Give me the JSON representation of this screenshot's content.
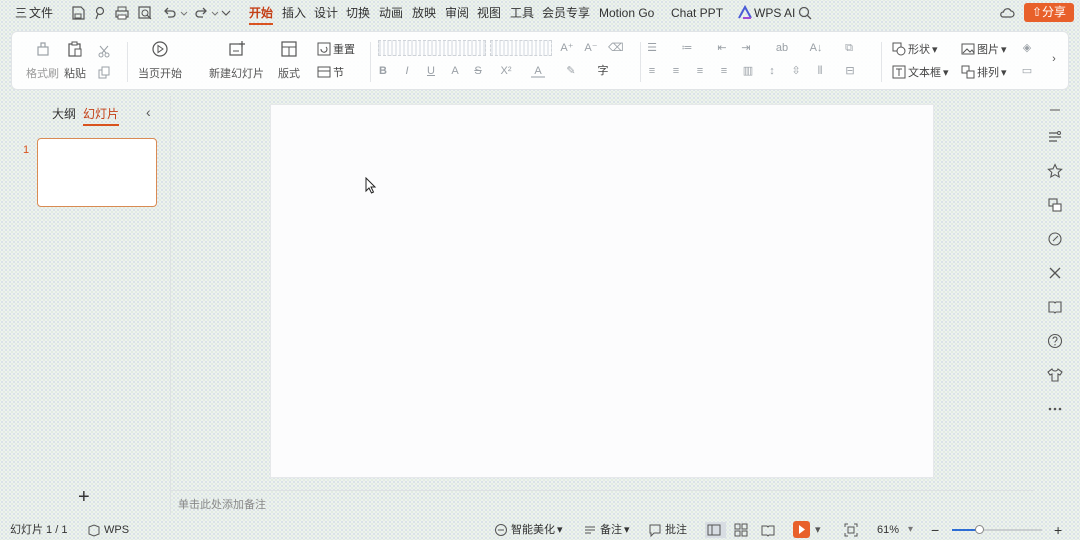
{
  "menubar": {
    "hamburger_label": "三",
    "file": "文件",
    "tabs": [
      "开始",
      "插入",
      "设计",
      "切换",
      "动画",
      "放映",
      "审阅",
      "视图",
      "工具",
      "会员专享",
      "Motion Go",
      "Chat PPT",
      "WPS AI"
    ],
    "active_tab": "开始",
    "share": "分享",
    "accent": "#e8602a"
  },
  "ribbon": {
    "format_painter": "格式刷",
    "paste": "粘贴",
    "play_from_current": "当页开始",
    "new_slide": "新建幻灯片",
    "layout": "版式",
    "reset": "重置",
    "section": "节",
    "shape": "形状",
    "picture": "图片",
    "textbox": "文本框",
    "arrange": "排列",
    "font_buttons": [
      "B",
      "I",
      "U",
      "A",
      "S",
      "X²",
      "A",
      "A"
    ],
    "grow_font": "A⁺",
    "shrink_font": "A⁻"
  },
  "left_panel": {
    "tab_outline": "大纲",
    "tab_slides": "幻灯片",
    "collapse": "‹",
    "slide_number": "1",
    "add_slide": "+"
  },
  "notes": {
    "placeholder": "单击此处添加备注"
  },
  "statusbar": {
    "slide_counter": "幻灯片 1 / 1",
    "theme": "WPS",
    "smart_beautify": "智能美化",
    "notes": "备注",
    "comments": "批注",
    "zoom": "61%",
    "zoom_minus": "−",
    "zoom_plus": "+",
    "zoom_level": 0.3
  }
}
